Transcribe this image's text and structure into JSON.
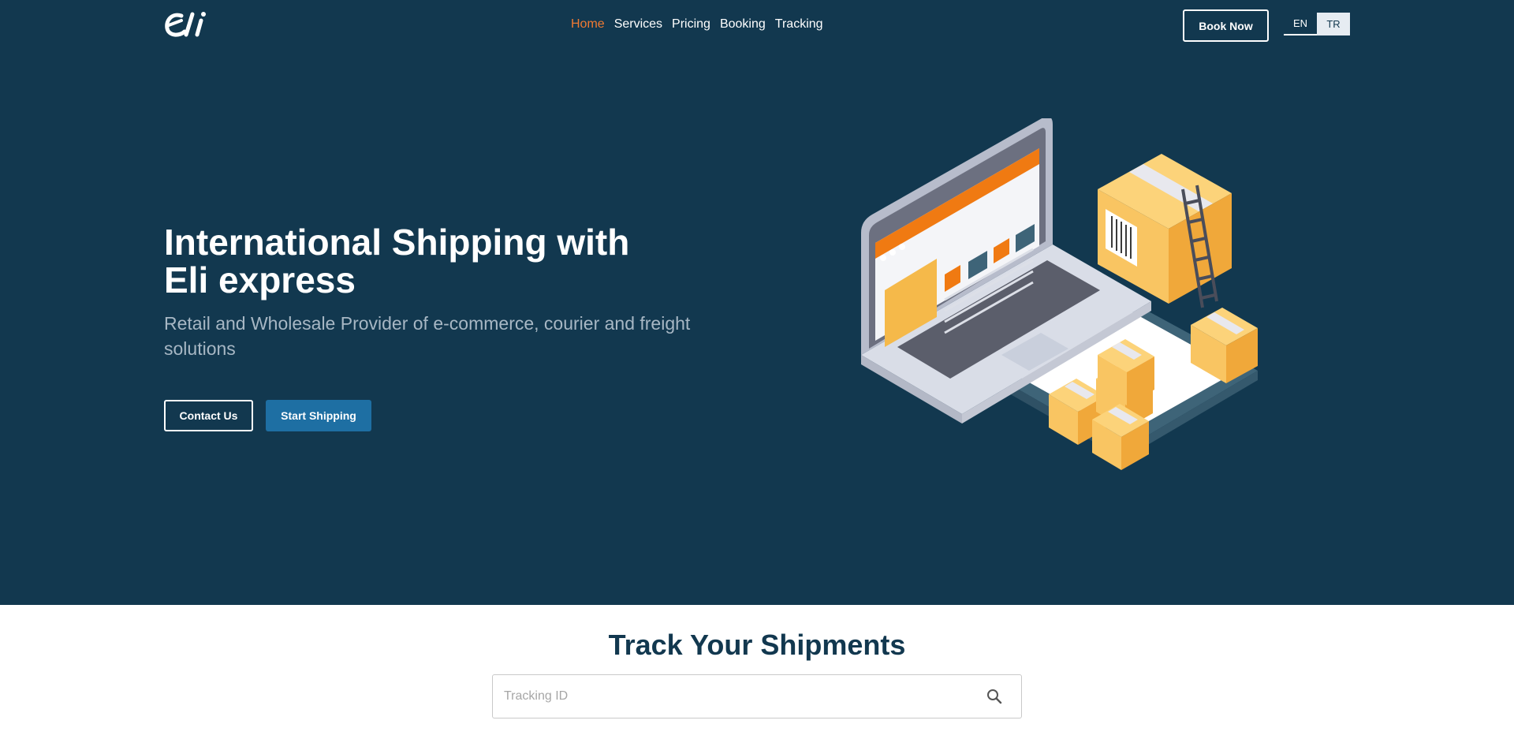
{
  "brand": {
    "logo_text": "eli"
  },
  "nav": {
    "items": [
      {
        "label": "Home",
        "active": true
      },
      {
        "label": "Services",
        "active": false
      },
      {
        "label": "Pricing",
        "active": false
      },
      {
        "label": "Booking",
        "active": false
      },
      {
        "label": "Tracking",
        "active": false
      }
    ]
  },
  "header": {
    "book_label": "Book Now",
    "languages": [
      "EN",
      "TR"
    ],
    "selected_language": "EN"
  },
  "hero": {
    "title_line1": "International Shipping with",
    "title_line2": "Eli express",
    "subtitle": "Retail and Wholesale Provider of e-commerce, courier and freight solutions",
    "contact_label": "Contact Us",
    "start_label": "Start Shipping",
    "illustration_icon": "laptop-boxes-illustration"
  },
  "tracking": {
    "title": "Track Your Shipments",
    "placeholder": "Tracking ID",
    "value": "",
    "search_icon": "search-icon"
  },
  "colors": {
    "hero_bg": "#12384f",
    "accent": "#f07a32",
    "primary_button": "#1e6fa3",
    "title_dark": "#12384f"
  }
}
